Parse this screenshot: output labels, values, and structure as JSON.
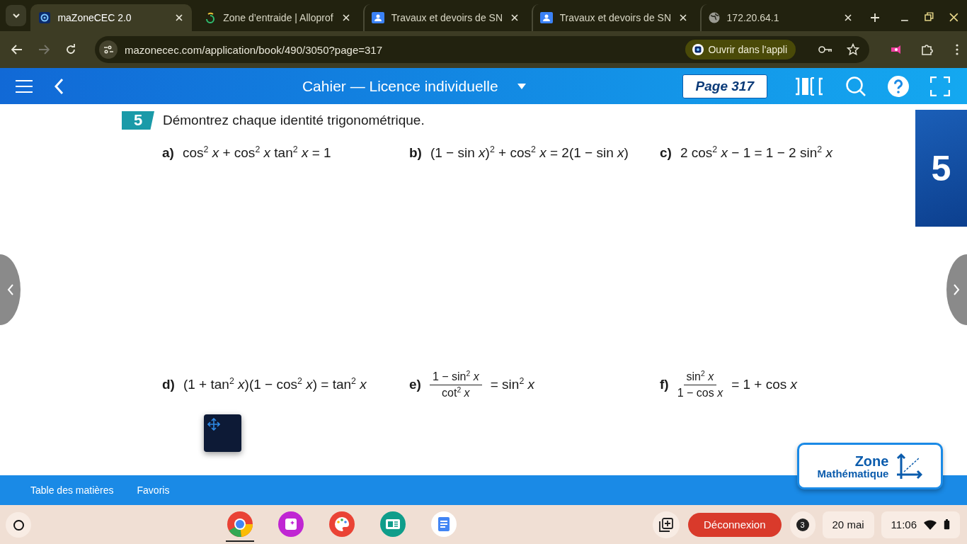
{
  "browser": {
    "tabs": [
      {
        "title": "maZoneCEC 2.0",
        "selected": true
      },
      {
        "title": "Zone d’entraide | Alloprof",
        "selected": false
      },
      {
        "title": "Travaux et devoirs de SN",
        "selected": false
      },
      {
        "title": "Travaux et devoirs de SN",
        "selected": false
      },
      {
        "title": "172.20.64.1",
        "selected": false
      }
    ],
    "url": "mazonecec.com/application/book/490/3050?page=317",
    "open_in_app": "Ouvrir dans l'appli"
  },
  "app": {
    "title": "Cahier — Licence individuelle",
    "page": "Page 317",
    "chapter": "5",
    "exercise": {
      "number": "5",
      "instruction": "Démontrez chaque identité trigonométrique.",
      "rows": [
        [
          {
            "label": "a)",
            "kind": "inline",
            "expr": "cos$^{2}$ *x* + cos$^{2}$ *x* tan$^{2}$ *x* = 1"
          },
          {
            "label": "b)",
            "kind": "inline",
            "expr": "(1 − sin *x*)$^{2}$ + cos$^{2}$ *x* = 2(1 − sin *x*)"
          },
          {
            "label": "c)",
            "kind": "inline",
            "expr": "2 cos$^{2}$ *x* − 1 = 1 − 2 sin$^{2}$ *x*"
          }
        ],
        [
          {
            "label": "d)",
            "kind": "inline",
            "expr": "(1 + tan$^{2}$ *x*)(1 − cos$^{2}$ *x*) = tan$^{2}$ *x*"
          },
          {
            "label": "e)",
            "kind": "fraction",
            "numerator": "1 − sin$^{2}$ *x*",
            "denominator": "cot$^{2}$ *x*",
            "rest": "= sin$^{2}$ *x*"
          },
          {
            "label": "f)",
            "kind": "fraction",
            "numerator": "sin$^{2}$ *x*",
            "denominator": "1 − cos *x*",
            "rest": "= 1 + cos *x*"
          }
        ]
      ]
    },
    "logo": {
      "line1": "Zone",
      "line2": "Mathématique"
    },
    "bottom_links": [
      "Table des matières",
      "Favoris"
    ]
  },
  "shelf": {
    "apps": [
      {
        "active": true
      },
      {
        "active": false
      },
      {
        "active": false
      },
      {
        "active": false
      },
      {
        "active": false
      }
    ],
    "logout": "Déconnexion",
    "notifications": "3",
    "date": "20 mai",
    "time": "11:06"
  }
}
